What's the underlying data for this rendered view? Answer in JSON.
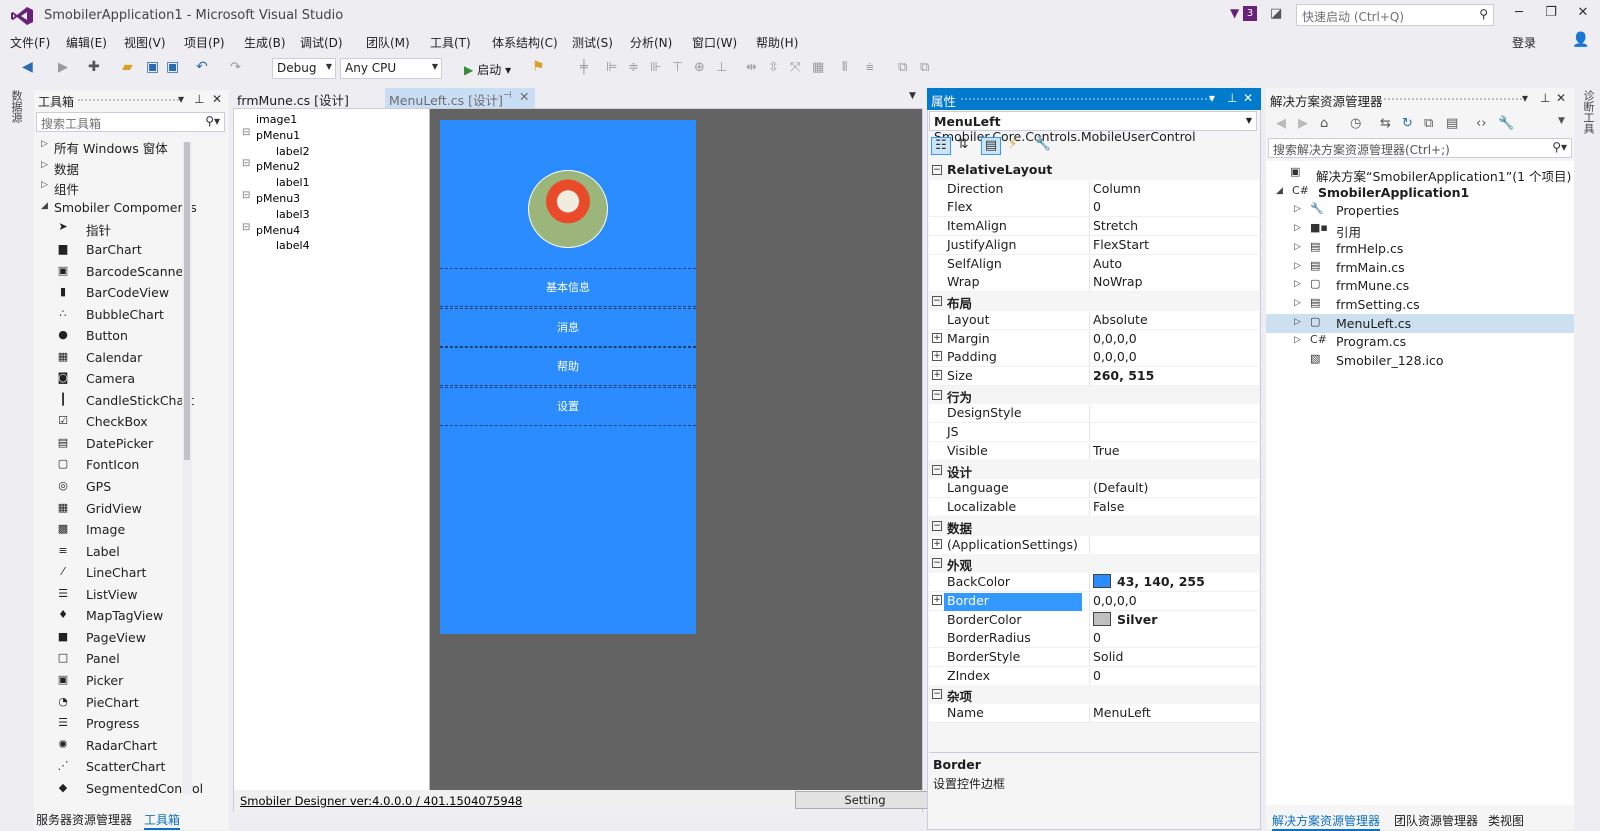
{
  "window": {
    "title": "SmobilerApplication1 - Microsoft Visual Studio",
    "notification_count": "3",
    "quick_launch_placeholder": "快速启动 (Ctrl+Q)",
    "login": "登录",
    "accent_color": "#68217a"
  },
  "menu": [
    "文件(F)",
    "编辑(E)",
    "视图(V)",
    "项目(P)",
    "生成(B)",
    "调试(D)",
    "团队(M)",
    "工具(T)",
    "体系结构(C)",
    "测试(S)",
    "分析(N)",
    "窗口(W)",
    "帮助(H)"
  ],
  "toolbar": {
    "config": "Debug",
    "platform": "Any CPU",
    "start_label": "启动"
  },
  "side_strips": {
    "left": "数据源",
    "right": "诊断工具"
  },
  "toolbox": {
    "title": "工具箱",
    "search_placeholder": "搜索工具箱",
    "groups": [
      "所有 Windows 窗体",
      "数据",
      "组件",
      "Smobiler Compoments"
    ],
    "items": [
      {
        "icon": "pointer-icon",
        "glyph": "➤",
        "label": "指针"
      },
      {
        "icon": "barchart-icon",
        "glyph": "▆",
        "label": "BarChart"
      },
      {
        "icon": "barcode-scanner-icon",
        "glyph": "▣",
        "label": "BarcodeScanner"
      },
      {
        "icon": "barcode-icon",
        "glyph": "▮",
        "label": "BarCodeView"
      },
      {
        "icon": "bubblechart-icon",
        "glyph": "∴",
        "label": "BubbleChart"
      },
      {
        "icon": "button-icon",
        "glyph": "●",
        "label": "Button"
      },
      {
        "icon": "calendar-icon",
        "glyph": "▦",
        "label": "Calendar"
      },
      {
        "icon": "camera-icon",
        "glyph": "◙",
        "label": "Camera"
      },
      {
        "icon": "candlestick-icon",
        "glyph": "┃",
        "label": "CandleStickChart"
      },
      {
        "icon": "checkbox-icon",
        "glyph": "☑",
        "label": "CheckBox"
      },
      {
        "icon": "datepicker-icon",
        "glyph": "▤",
        "label": "DatePicker"
      },
      {
        "icon": "fonticon-icon",
        "glyph": "▢",
        "label": "FontIcon"
      },
      {
        "icon": "gps-icon",
        "glyph": "◎",
        "label": "GPS"
      },
      {
        "icon": "gridview-icon",
        "glyph": "▦",
        "label": "GridView"
      },
      {
        "icon": "image-icon",
        "glyph": "▩",
        "label": "Image"
      },
      {
        "icon": "label-icon",
        "glyph": "≡",
        "label": "Label"
      },
      {
        "icon": "linechart-icon",
        "glyph": "⁄",
        "label": "LineChart"
      },
      {
        "icon": "listview-icon",
        "glyph": "☰",
        "label": "ListView"
      },
      {
        "icon": "maptag-icon",
        "glyph": "♦",
        "label": "MapTagView"
      },
      {
        "icon": "pageview-icon",
        "glyph": "■",
        "label": "PageView"
      },
      {
        "icon": "panel-icon",
        "glyph": "□",
        "label": "Panel"
      },
      {
        "icon": "picker-icon",
        "glyph": "▣",
        "label": "Picker"
      },
      {
        "icon": "piechart-icon",
        "glyph": "◔",
        "label": "PieChart"
      },
      {
        "icon": "progress-icon",
        "glyph": "☰",
        "label": "Progress"
      },
      {
        "icon": "radarchart-icon",
        "glyph": "✺",
        "label": "RadarChart"
      },
      {
        "icon": "scatterchart-icon",
        "glyph": "⋰",
        "label": "ScatterChart"
      },
      {
        "icon": "segmented-icon",
        "glyph": "◆",
        "label": "SegmentedControl"
      }
    ],
    "bottom_tabs": [
      "服务器资源管理器",
      "工具箱"
    ]
  },
  "designer": {
    "tabs": [
      "frmMune.cs [设计]",
      "MenuLeft.cs [设计]"
    ],
    "tree": [
      {
        "label": "image1",
        "level": 0
      },
      {
        "label": "pMenu1",
        "level": 0
      },
      {
        "label": "label2",
        "level": 1
      },
      {
        "label": "pMenu2",
        "level": 0
      },
      {
        "label": "label1",
        "level": 1
      },
      {
        "label": "pMenu3",
        "level": 0
      },
      {
        "label": "label3",
        "level": 1
      },
      {
        "label": "pMenu4",
        "level": 0
      },
      {
        "label": "label4",
        "level": 1
      }
    ],
    "menu_items": [
      "基本信息",
      "消息",
      "帮助",
      "设置"
    ],
    "phone_color": "#2b8cff",
    "version": "Smobiler Designer ver:4.0.0.0 / 401.1504075948",
    "setting_button": "Setting"
  },
  "properties": {
    "title": "属性",
    "object_name": "MenuLeft",
    "object_type": "Smobiler.Core.Controls.MobileUserControl",
    "rows": [
      {
        "kind": "cat",
        "name": "RelativeLayout"
      },
      {
        "kind": "prop",
        "name": "Direction",
        "value": "Column"
      },
      {
        "kind": "prop",
        "name": "Flex",
        "value": "0"
      },
      {
        "kind": "prop",
        "name": "ItemAlign",
        "value": "Stretch"
      },
      {
        "kind": "prop",
        "name": "JustifyAlign",
        "value": "FlexStart"
      },
      {
        "kind": "prop",
        "name": "SelfAlign",
        "value": "Auto"
      },
      {
        "kind": "prop",
        "name": "Wrap",
        "value": "NoWrap"
      },
      {
        "kind": "cat",
        "name": "布局"
      },
      {
        "kind": "prop",
        "name": "Layout",
        "value": "Absolute"
      },
      {
        "kind": "prop",
        "name": "Margin",
        "value": "0,0,0,0",
        "expand": true
      },
      {
        "kind": "prop",
        "name": "Padding",
        "value": "0,0,0,0",
        "expand": true
      },
      {
        "kind": "prop",
        "name": "Size",
        "value": "260, 515",
        "expand": true,
        "bold": true
      },
      {
        "kind": "cat",
        "name": "行为"
      },
      {
        "kind": "prop",
        "name": "DesignStyle",
        "value": ""
      },
      {
        "kind": "prop",
        "name": "JS",
        "value": ""
      },
      {
        "kind": "prop",
        "name": "Visible",
        "value": "True"
      },
      {
        "kind": "cat",
        "name": "设计"
      },
      {
        "kind": "prop",
        "name": "Language",
        "value": "(Default)"
      },
      {
        "kind": "prop",
        "name": "Localizable",
        "value": "False"
      },
      {
        "kind": "cat",
        "name": "数据"
      },
      {
        "kind": "prop",
        "name": "(ApplicationSettings)",
        "value": "",
        "expand": true
      },
      {
        "kind": "cat",
        "name": "外观"
      },
      {
        "kind": "prop",
        "name": "BackColor",
        "value": "43, 140, 255",
        "swatch": "#2b8cff",
        "bold": true
      },
      {
        "kind": "prop",
        "name": "Border",
        "value": "0,0,0,0",
        "expand": true,
        "selected": true
      },
      {
        "kind": "prop",
        "name": "BorderColor",
        "value": "Silver",
        "swatch": "#c0c0c0",
        "bold": true
      },
      {
        "kind": "prop",
        "name": "BorderRadius",
        "value": "0"
      },
      {
        "kind": "prop",
        "name": "BorderStyle",
        "value": "Solid"
      },
      {
        "kind": "prop",
        "name": "ZIndex",
        "value": "0"
      },
      {
        "kind": "cat",
        "name": "杂项"
      },
      {
        "kind": "prop",
        "name": "Name",
        "value": "MenuLeft"
      }
    ],
    "desc_title": "Border",
    "desc_text": "设置控件边框",
    "selection_color": "#3399ff"
  },
  "solution": {
    "title": "解决方案资源管理器",
    "search_placeholder": "搜索解决方案资源管理器(Ctrl+;)",
    "nodes": [
      {
        "label": "解决方案“SmobilerApplication1”(1 个项目)",
        "level": 0,
        "icon": "solution-icon",
        "glyph": "▣",
        "tri": ""
      },
      {
        "label": "SmobilerApplication1",
        "level": 1,
        "icon": "csharp-project-icon",
        "glyph": "C#",
        "tri": "◢",
        "bold": true
      },
      {
        "label": "Properties",
        "level": 2,
        "icon": "wrench-icon",
        "glyph": "🔧",
        "tri": "▷"
      },
      {
        "label": "引用",
        "level": 2,
        "icon": "references-icon",
        "glyph": "■▪",
        "tri": "▷"
      },
      {
        "label": "frmHelp.cs",
        "level": 2,
        "icon": "form-icon",
        "glyph": "▤",
        "tri": "▷"
      },
      {
        "label": "frmMain.cs",
        "level": 2,
        "icon": "form-icon",
        "glyph": "▤",
        "tri": "▷"
      },
      {
        "label": "frmMune.cs",
        "level": 2,
        "icon": "usercontrol-icon",
        "glyph": "▢",
        "tri": "▷"
      },
      {
        "label": "frmSetting.cs",
        "level": 2,
        "icon": "form-icon",
        "glyph": "▤",
        "tri": "▷"
      },
      {
        "label": "MenuLeft.cs",
        "level": 2,
        "icon": "usercontrol-icon",
        "glyph": "▢",
        "tri": "▷",
        "selected": true
      },
      {
        "label": "Program.cs",
        "level": 2,
        "icon": "csharp-file-icon",
        "glyph": "C#",
        "tri": "▷"
      },
      {
        "label": "Smobiler_128.ico",
        "level": 2,
        "icon": "ico-file-icon",
        "glyph": "▧",
        "tri": ""
      }
    ],
    "bottom_tabs": [
      "解决方案资源管理器",
      "团队资源管理器",
      "类视图"
    ]
  }
}
